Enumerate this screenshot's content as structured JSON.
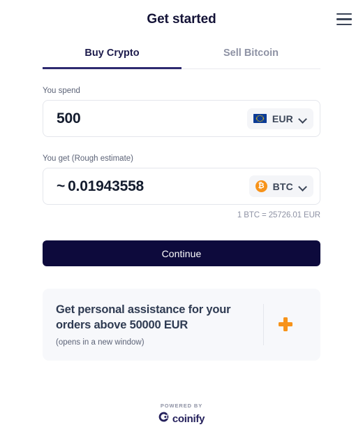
{
  "header": {
    "title": "Get started",
    "menu_icon": "hamburger-menu-icon"
  },
  "tabs": [
    {
      "label": "Buy Crypto",
      "active": true
    },
    {
      "label": "Sell Bitcoin",
      "active": false
    }
  ],
  "spend": {
    "label": "You spend",
    "amount": "500",
    "currency_code": "EUR",
    "currency_icon": "eu-flag-icon",
    "chevron_icon": "chevron-down-icon"
  },
  "receive": {
    "label": "You get (Rough estimate)",
    "tilde": "~",
    "amount": "0.01943558",
    "currency_code": "BTC",
    "currency_icon": "bitcoin-coin-icon",
    "currency_symbol": "₿",
    "chevron_icon": "chevron-down-icon"
  },
  "rate": "1 BTC = 25726.01 EUR",
  "continue": {
    "label": "Continue"
  },
  "promo": {
    "title": "Get personal assistance for your orders above 50000 EUR",
    "subtitle": "(opens in a new window)",
    "icon": "orange-plus-icon"
  },
  "footer": {
    "powered_by": "POWERED BY",
    "brand": "coinify",
    "brand_icon": "coinify-logo-icon"
  },
  "colors": {
    "accent_navy": "#0d0a3c",
    "tab_active": "#2e2a70",
    "bitcoin_orange": "#f7931a",
    "eu_blue": "#0b3b96",
    "muted_text": "#8e92a4"
  }
}
